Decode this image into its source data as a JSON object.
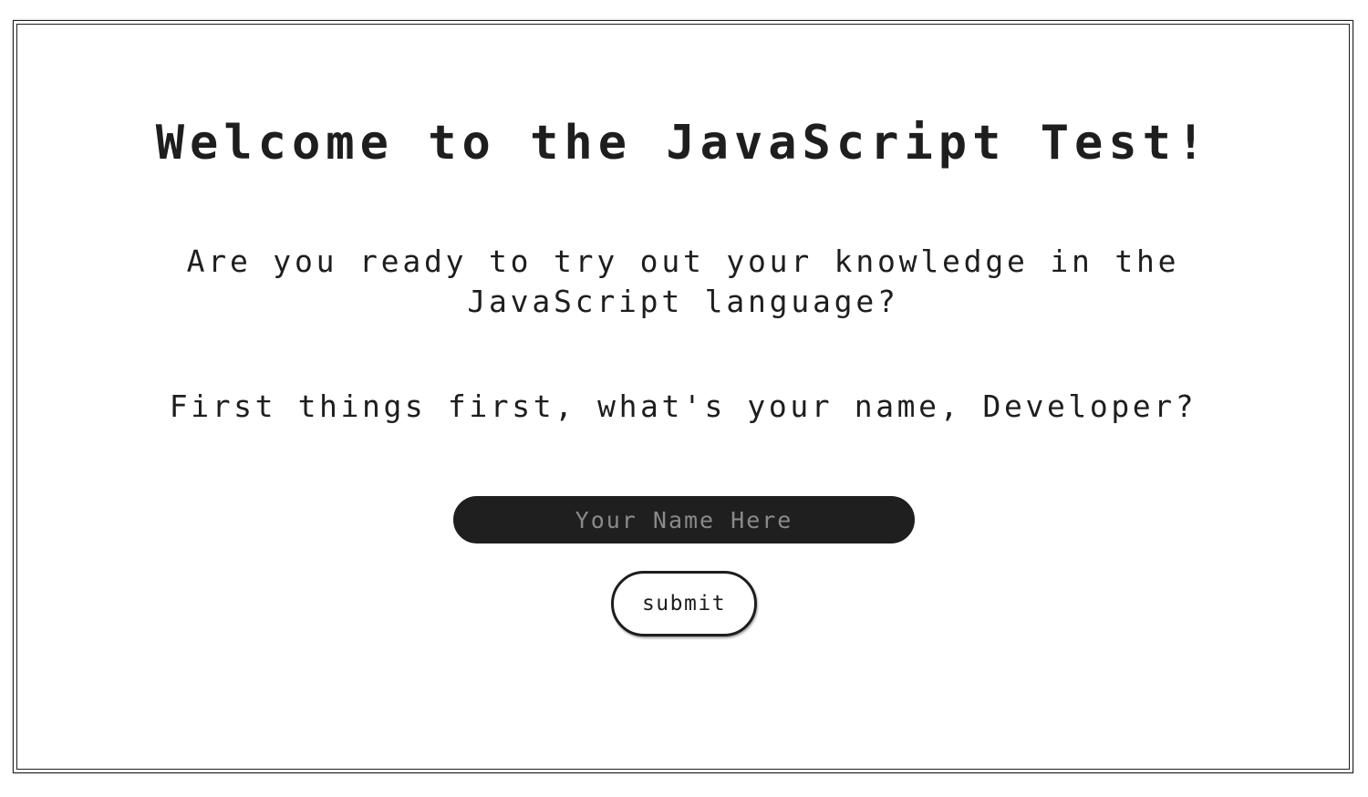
{
  "page": {
    "title": "Welcome to the JavaScript Test!",
    "intro": "Are you ready to try out your knowledge in the JavaScript language?",
    "question": "First things first, what's your name, Developer?"
  },
  "form": {
    "name_placeholder": "Your Name Here",
    "name_value": "",
    "submit_label": "submit"
  },
  "colors": {
    "text": "#1e1e1e",
    "input_background": "#1f1f1f",
    "placeholder": "#8a8a8a",
    "background": "#ffffff"
  }
}
